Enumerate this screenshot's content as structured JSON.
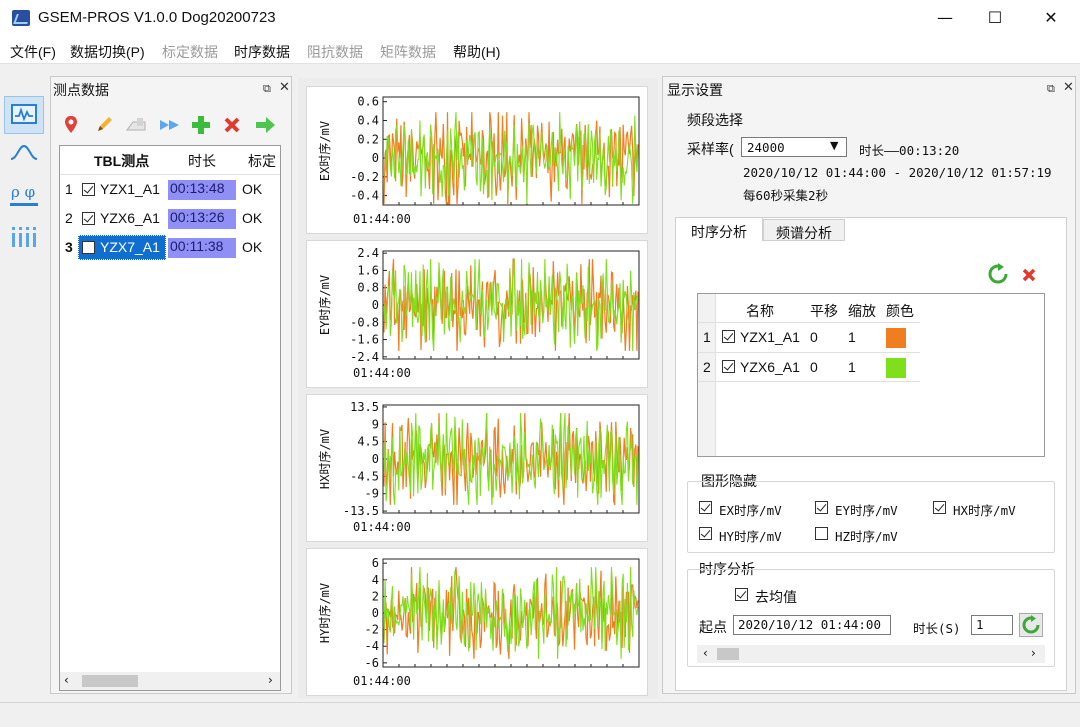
{
  "window": {
    "title": "GSEM-PROS V1.0.0  Dog20200723",
    "minimize": "—",
    "maximize": "☐",
    "close": "✕"
  },
  "menu": [
    "文件(F)",
    "数据切换(P)",
    "标定数据",
    "时序数据",
    "阻抗数据",
    "矩阵数据",
    "帮助(H)"
  ],
  "menu_disabled": [
    false,
    false,
    true,
    false,
    true,
    true,
    false
  ],
  "left_panel": {
    "title": "测点数据",
    "headers": [
      "TBL测点",
      "时长",
      "标定"
    ],
    "rows": [
      {
        "index": "1",
        "name": "YZX1_A1",
        "duration": "00:13:48",
        "calib": "OK",
        "checked": true
      },
      {
        "index": "2",
        "name": "YZX6_A1",
        "duration": "00:13:26",
        "calib": "OK",
        "checked": true
      },
      {
        "index": "3",
        "name": "YZX7_A1",
        "duration": "00:11:38",
        "calib": "OK",
        "checked": false
      }
    ]
  },
  "charts": [
    {
      "ylabel": "EX时序/mV",
      "xtick": "01:44:00",
      "ticks": [
        "0.6",
        "0.4",
        "0.2",
        "0",
        "-0.2",
        "-0.4"
      ],
      "ylim": [
        -0.5,
        0.65
      ],
      "series": [
        "#f07d1e",
        "#7ee01a"
      ]
    },
    {
      "ylabel": "EY时序/mV",
      "xtick": "01:44:00",
      "ticks": [
        "2.4",
        "1.6",
        "0.8",
        "0",
        "-0.8",
        "-1.6",
        "-2.4"
      ],
      "ylim": [
        -2.5,
        2.5
      ],
      "series": [
        "#f07d1e",
        "#7ee01a"
      ]
    },
    {
      "ylabel": "HX时序/mV",
      "xtick": "01:44:00",
      "ticks": [
        "13.5",
        "9",
        "4.5",
        "0",
        "-4.5",
        "-9",
        "-13.5"
      ],
      "ylim": [
        -14,
        14
      ],
      "series": [
        "#f07d1e",
        "#7ee01a"
      ]
    },
    {
      "ylabel": "HY时序/mV",
      "xtick": "01:44:00",
      "ticks": [
        "6",
        "4",
        "2",
        "0",
        "-2",
        "-4",
        "-6"
      ],
      "ylim": [
        -6.5,
        6.5
      ],
      "series": [
        "#f07d1e",
        "#7ee01a"
      ]
    }
  ],
  "right_panel": {
    "title": "显示设置",
    "band_group": "频段选择",
    "sample_label": "采样率(",
    "sample_value": "24000",
    "duration_text": "时长——00:13:20",
    "range_text": "2020/10/12 01:44:00 - 2020/10/12 01:57:19",
    "rate_text": "每60秒采集2秒",
    "tabs": [
      "时序分析",
      "频谱分析"
    ],
    "table_headers": [
      "名称",
      "平移",
      "缩放",
      "颜色"
    ],
    "table_rows": [
      {
        "index": "1",
        "name": "YZX1_A1",
        "offset": "0",
        "scale": "1",
        "color": "#f07d1e",
        "checked": true
      },
      {
        "index": "2",
        "name": "YZX6_A1",
        "offset": "0",
        "scale": "1",
        "color": "#7ee01a",
        "checked": true
      }
    ],
    "hide_group": "图形隐藏",
    "hide_items": [
      {
        "label": "EX时序/mV",
        "checked": true
      },
      {
        "label": "EY时序/mV",
        "checked": true
      },
      {
        "label": "HX时序/mV",
        "checked": true
      },
      {
        "label": "HY时序/mV",
        "checked": true
      },
      {
        "label": "HZ时序/mV",
        "checked": false
      }
    ],
    "ts_group": "时序分析",
    "demean_label": "去均值",
    "start_label": "起点",
    "start_value": "2020/10/12 01:44:00",
    "dur_label": "时长(S)",
    "dur_value": "1"
  }
}
